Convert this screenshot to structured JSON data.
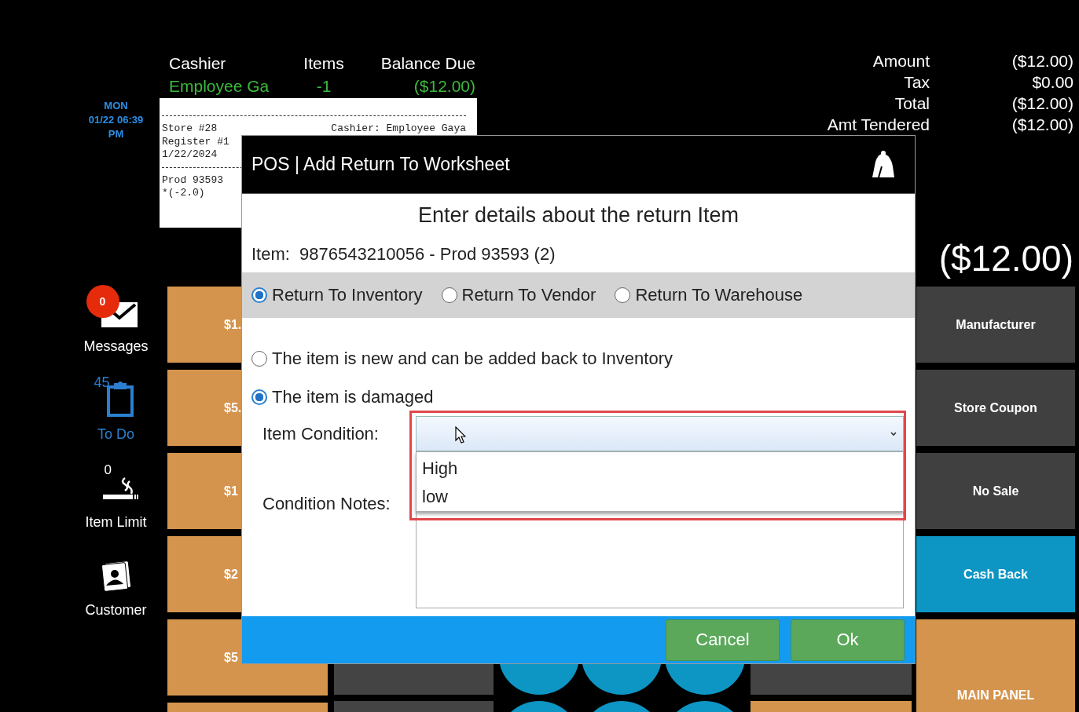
{
  "clock": {
    "lines": [
      "MON",
      "01/22 06:39",
      "PM"
    ]
  },
  "sale_summary": [
    {
      "label": "Cashier",
      "value": "Employee Ga"
    },
    {
      "label": "Items",
      "value": "-1"
    },
    {
      "label": "Balance Due",
      "value": "($12.00)"
    }
  ],
  "receipt": {
    "lines": [
      {
        "kind": "rule"
      },
      {
        "kind": "text",
        "left": "Store #28",
        "right": "Cashier: Employee Gaya"
      },
      {
        "kind": "text",
        "left": "Register #1"
      },
      {
        "kind": "text",
        "left": "1/22/2024"
      },
      {
        "kind": "rule"
      },
      {
        "kind": "text",
        "left": "Prod 93593"
      },
      {
        "kind": "text",
        "left": "*(-2.0)"
      }
    ]
  },
  "totals": [
    {
      "label": "Amount",
      "value": "($12.00)"
    },
    {
      "label": "Tax",
      "value": "$0.00"
    },
    {
      "label": "Total",
      "value": "($12.00)"
    },
    {
      "label": "Amt Tendered",
      "value": "($12.00)"
    }
  ],
  "big_total": "($12.00)",
  "sidebar": [
    {
      "kind": "messages",
      "label": "Messages",
      "badge": "0"
    },
    {
      "kind": "todo",
      "label": "To Do",
      "count": "45"
    },
    {
      "kind": "item_limit",
      "label": "Item Limit",
      "count": "0"
    },
    {
      "kind": "customer",
      "label": "Customer"
    }
  ],
  "tender_buttons": [
    "$1.",
    "$5.",
    "$1",
    "$2",
    "$5"
  ],
  "function_buttons": [
    {
      "label": "Manufacturer",
      "color": "#404040"
    },
    {
      "label": "Store Coupon",
      "color": "#404040"
    },
    {
      "label": "No Sale",
      "color": "#404040"
    },
    {
      "label": "Cash Back",
      "color": "#0d95c4"
    },
    {
      "label": "MAIN PANEL",
      "color": "#d4944e"
    }
  ],
  "dialog": {
    "title": "POS | Add Return To Worksheet",
    "heading": "Enter details about the return Item",
    "item_line": "Item:  9876543210056 - Prod 93593 (2)",
    "return_options": [
      {
        "label": "Return To Inventory",
        "selected": true
      },
      {
        "label": "Return To Vendor",
        "selected": false
      },
      {
        "label": "Return To Warehouse",
        "selected": false
      }
    ],
    "condition_options": [
      {
        "label": "The item is new and can be added back to Inventory",
        "selected": false
      },
      {
        "label": "The item is damaged",
        "selected": true
      }
    ],
    "item_condition": {
      "label": "Item Condition:",
      "expanded": true,
      "options": [
        "High",
        "low"
      ]
    },
    "condition_notes": {
      "label": "Condition Notes:"
    },
    "buttons": [
      "Cancel",
      "Ok"
    ]
  }
}
